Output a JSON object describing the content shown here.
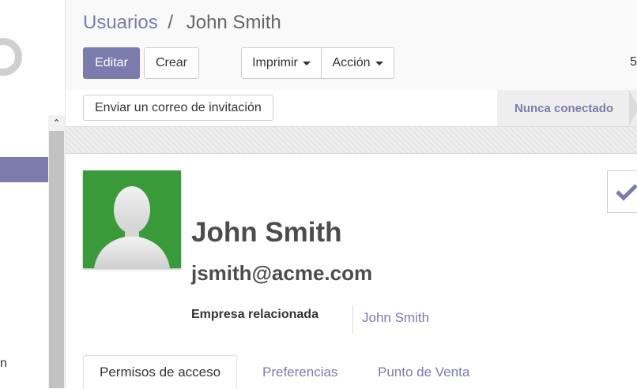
{
  "breadcrumb": {
    "parent": "Usuarios",
    "separator": "/",
    "current": "John Smith"
  },
  "toolbar": {
    "edit_label": "Editar",
    "create_label": "Crear",
    "print_label": "Imprimir",
    "action_label": "Acción"
  },
  "pager": {
    "text": "5"
  },
  "statusbar": {
    "invite_label": "Enviar un correo de invitación",
    "stage_label": "Nunca conectado"
  },
  "sidebar": {
    "scroll_up_glyph": "⌃",
    "partial_item_text": "n"
  },
  "record": {
    "name": "John Smith",
    "email": "jsmith@acme.com",
    "related_company_label": "Empresa relacionada",
    "related_company_value": "John Smith"
  },
  "tabs": [
    {
      "label": "Permisos de acceso",
      "active": true
    },
    {
      "label": "Preferencias",
      "active": false
    },
    {
      "label": "Punto de Venta",
      "active": false
    }
  ],
  "colors": {
    "accent": "#7c7bad",
    "avatar_bg": "#3a9a3a",
    "text": "#4c4c4c"
  },
  "icons": {
    "avatar": "user-silhouette-icon",
    "active_toggle": "checkmark-icon",
    "dropdown": "caret-down-icon"
  }
}
